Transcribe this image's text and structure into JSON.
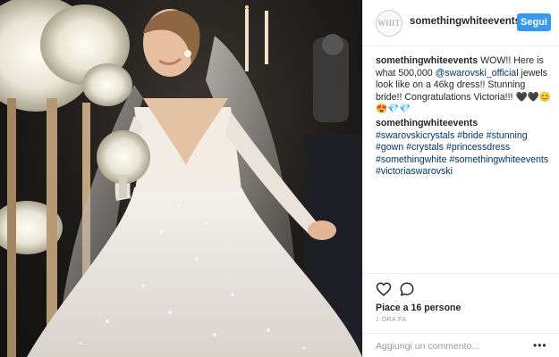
{
  "post": {
    "image_alt": "Bride in crystal-embellished ball gown holding a white bouquet",
    "username": "somethingwhiteevents",
    "avatar_text": "WHIT",
    "follow_label": "Segui",
    "caption": {
      "username": "somethingwhiteevents",
      "text_before": " WOW!! Here is what 500,000 ",
      "mention": "@swarovski_official",
      "text_after": " jewels look like on a 46kg dress!! Stunning bride!! Congratulations Victoria!!! 🖤🖤😊😍💎💎"
    },
    "comment": {
      "username": "somethingwhiteevents",
      "tags": [
        "#swarovskicrystals",
        "#bride",
        "#stunning",
        "#gown",
        "#crystals",
        "#princessdress",
        "#somethingwhite",
        "#somethingwhiteevents",
        "#victoriaswarovski"
      ]
    },
    "likes": "Piace a 16 persone",
    "time": "1 ORA FA",
    "comment_placeholder": "Aggiungi un commento...",
    "more_label": "•••",
    "icons": {
      "like": "heart-icon",
      "comment": "comment-icon",
      "options": "more-options-icon"
    },
    "colors": {
      "follow": "#3897f0",
      "link": "#003569"
    }
  }
}
